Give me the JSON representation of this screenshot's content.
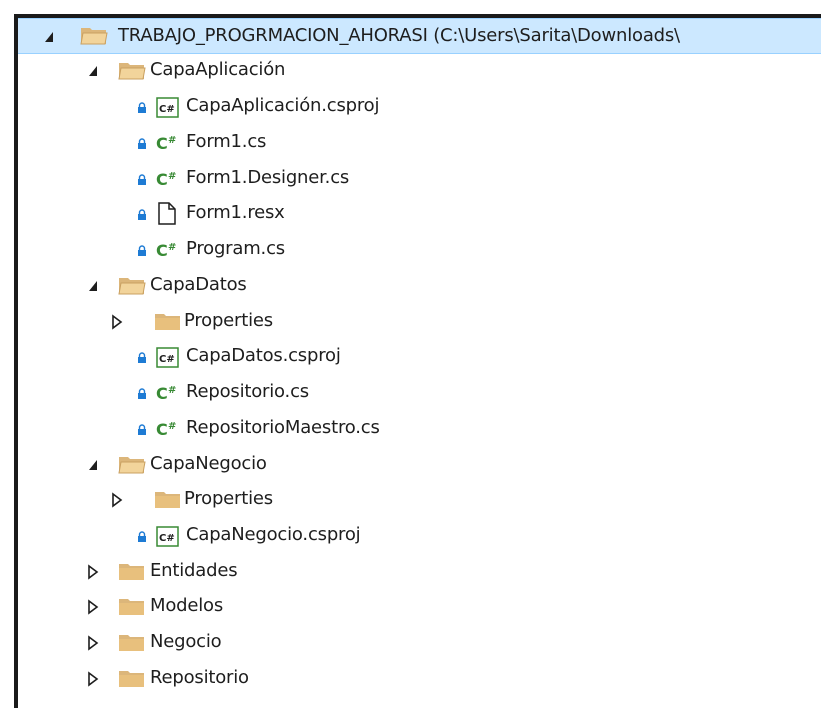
{
  "tree": {
    "root": {
      "label": "TRABAJO_PROGRMACION_AHORASI (C:\\Users\\Sarita\\Downloads\\"
    },
    "nodes": [
      {
        "label": "CapaAplicación",
        "icon": "folder-open-icon",
        "expander": "expanded"
      },
      {
        "label": "CapaAplicación.csproj",
        "icon": "csproj-icon",
        "locked": true
      },
      {
        "label": "Form1.cs",
        "icon": "csharp-file-icon",
        "locked": true
      },
      {
        "label": "Form1.Designer.cs",
        "icon": "csharp-file-icon",
        "locked": true
      },
      {
        "label": "Form1.resx",
        "icon": "document-icon",
        "locked": true
      },
      {
        "label": "Program.cs",
        "icon": "csharp-file-icon",
        "locked": true
      },
      {
        "label": "CapaDatos",
        "icon": "folder-open-icon",
        "expander": "expanded"
      },
      {
        "label": "Properties",
        "icon": "folder-icon",
        "expander": "collapsed"
      },
      {
        "label": "CapaDatos.csproj",
        "icon": "csproj-icon",
        "locked": true
      },
      {
        "label": "Repositorio.cs",
        "icon": "csharp-file-icon",
        "locked": true
      },
      {
        "label": "RepositorioMaestro.cs",
        "icon": "csharp-file-icon",
        "locked": true
      },
      {
        "label": "CapaNegocio",
        "icon": "folder-open-icon",
        "expander": "expanded"
      },
      {
        "label": "Properties",
        "icon": "folder-icon",
        "expander": "collapsed"
      },
      {
        "label": "CapaNegocio.csproj",
        "icon": "csproj-icon",
        "locked": true
      },
      {
        "label": "Entidades",
        "icon": "folder-icon",
        "expander": "collapsed"
      },
      {
        "label": "Modelos",
        "icon": "folder-icon",
        "expander": "collapsed"
      },
      {
        "label": "Negocio",
        "icon": "folder-icon",
        "expander": "collapsed"
      },
      {
        "label": "Repositorio",
        "icon": "folder-icon",
        "expander": "collapsed"
      }
    ]
  },
  "colors": {
    "selection": "#cce8ff",
    "folder": "#dcb67a",
    "csharp": "#388a34",
    "lock": "#1e7bd4"
  }
}
